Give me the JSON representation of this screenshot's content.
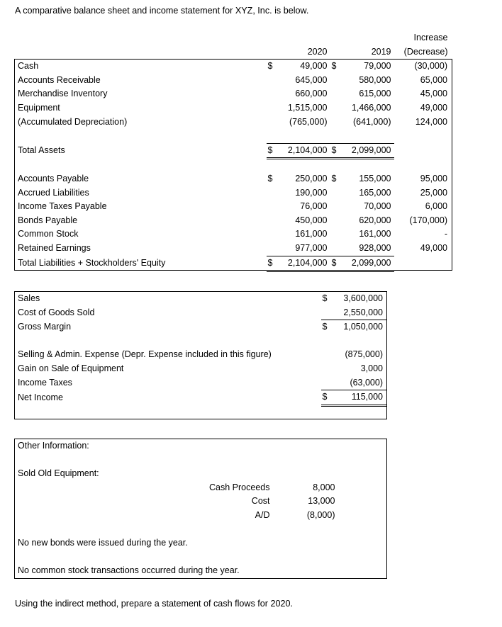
{
  "intro": "A comparative balance sheet and income statement for XYZ, Inc. is below.",
  "outro": "Using the indirect method, prepare a statement of cash flows for 2020.",
  "balance_sheet": {
    "headers": {
      "col_2020": "2020",
      "col_2019": "2019",
      "col_delta_line1": "Increase",
      "col_delta_line2": "(Decrease)"
    },
    "rows": [
      {
        "label": "Cash",
        "cur_2020": "$",
        "v2020": "49,000",
        "cur_2019": "$",
        "v2019": "79,000",
        "delta": "(30,000)"
      },
      {
        "label": "Accounts Receivable",
        "cur_2020": "",
        "v2020": "645,000",
        "cur_2019": "",
        "v2019": "580,000",
        "delta": "65,000"
      },
      {
        "label": "Merchandise Inventory",
        "cur_2020": "",
        "v2020": "660,000",
        "cur_2019": "",
        "v2019": "615,000",
        "delta": "45,000"
      },
      {
        "label": "Equipment",
        "cur_2020": "",
        "v2020": "1,515,000",
        "cur_2019": "",
        "v2019": "1,466,000",
        "delta": "49,000"
      },
      {
        "label": "(Accumulated Depreciation)",
        "cur_2020": "",
        "v2020": "(765,000)",
        "cur_2019": "",
        "v2019": "(641,000)",
        "delta": "124,000"
      }
    ],
    "total_assets": {
      "label": "Total Assets",
      "cur_2020": "$",
      "v2020": "2,104,000",
      "cur_2019": "$",
      "v2019": "2,099,000",
      "delta": ""
    },
    "rows2": [
      {
        "label": "Accounts Payable",
        "cur_2020": "$",
        "v2020": "250,000",
        "cur_2019": "$",
        "v2019": "155,000",
        "delta": "95,000"
      },
      {
        "label": "Accrued Liabilities",
        "cur_2020": "",
        "v2020": "190,000",
        "cur_2019": "",
        "v2019": "165,000",
        "delta": "25,000"
      },
      {
        "label": "Income Taxes Payable",
        "cur_2020": "",
        "v2020": "76,000",
        "cur_2019": "",
        "v2019": "70,000",
        "delta": "6,000"
      },
      {
        "label": "Bonds Payable",
        "cur_2020": "",
        "v2020": "450,000",
        "cur_2019": "",
        "v2019": "620,000",
        "delta": "(170,000)"
      },
      {
        "label": "Common Stock",
        "cur_2020": "",
        "v2020": "161,000",
        "cur_2019": "",
        "v2019": "161,000",
        "delta": "-"
      },
      {
        "label": "Retained Earnings",
        "cur_2020": "",
        "v2020": "977,000",
        "cur_2019": "",
        "v2019": "928,000",
        "delta": "49,000"
      }
    ],
    "total_liab_equity": {
      "label": "Total Liabilities + Stockholders' Equity",
      "cur_2020": "$",
      "v2020": "2,104,000",
      "cur_2019": "$",
      "v2019": "2,099,000",
      "delta": ""
    }
  },
  "income_statement": {
    "sales": {
      "label": "Sales",
      "cur": "$",
      "value": "3,600,000"
    },
    "cogs": {
      "label": "Cost of Goods Sold",
      "cur": "",
      "value": "2,550,000"
    },
    "gross_margin": {
      "label": "Gross Margin",
      "cur": "$",
      "value": "1,050,000"
    },
    "selling_admin": {
      "label": "Selling & Admin. Expense (Depr. Expense included in this figure)",
      "cur": "",
      "value": "(875,000)"
    },
    "gain_sale": {
      "label": "Gain on Sale of Equipment",
      "cur": "",
      "value": "3,000"
    },
    "income_taxes": {
      "label": "Income Taxes",
      "cur": "",
      "value": "(63,000)"
    },
    "net_income": {
      "label": "Net Income",
      "cur": "$",
      "value": "115,000"
    }
  },
  "other_information": {
    "title": "Other Information:",
    "sold_equipment_title": "Sold Old Equipment:",
    "sold_equipment_rows": [
      {
        "label": "Cash Proceeds",
        "value": "8,000"
      },
      {
        "label": "Cost",
        "value": "13,000"
      },
      {
        "label": "A/D",
        "value": "(8,000)"
      }
    ],
    "note_bonds": "No new bonds were issued during the year.",
    "note_stock": "No common stock transactions occurred during the year."
  }
}
